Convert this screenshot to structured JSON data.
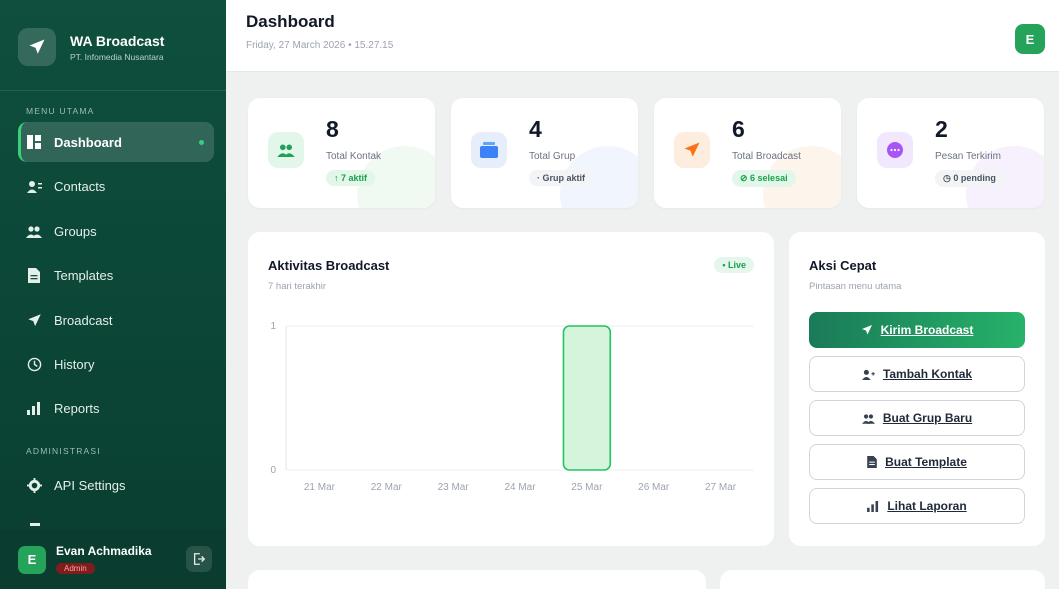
{
  "brand": {
    "name": "WA Broadcast",
    "subtitle": "PT. Infomedia Nusantara"
  },
  "sidebar": {
    "sections": {
      "main": "MENU UTAMA",
      "admin": "ADMINISTRASI"
    },
    "items": [
      {
        "label": "Dashboard",
        "icon": "dashboard-icon",
        "active": true
      },
      {
        "label": "Contacts",
        "icon": "contacts-icon"
      },
      {
        "label": "Groups",
        "icon": "groups-icon"
      },
      {
        "label": "Templates",
        "icon": "file-icon"
      },
      {
        "label": "Broadcast",
        "icon": "send-icon"
      },
      {
        "label": "History",
        "icon": "clock-icon"
      },
      {
        "label": "Reports",
        "icon": "bar-chart-icon"
      },
      {
        "label": "API Settings",
        "icon": "gear-icon"
      }
    ],
    "user": {
      "name": "Evan Achmadika",
      "role": "Admin",
      "initial": "E"
    }
  },
  "header": {
    "title": "Dashboard",
    "date": "Friday, 27 March 2026 • 15.27.15",
    "avatar_initial": "E"
  },
  "stats": [
    {
      "value": "8",
      "label": "Total Kontak",
      "badge": "↑ 7 aktif",
      "icon": "users-icon",
      "color": "#22a055"
    },
    {
      "value": "4",
      "label": "Total Grup",
      "badge": "· Grup aktif",
      "icon": "folder-icon",
      "color": "#3b82f6"
    },
    {
      "value": "6",
      "label": "Total Broadcast",
      "badge": "⊘ 6 selesai",
      "icon": "send-icon",
      "color": "#f97316"
    },
    {
      "value": "2",
      "label": "Pesan Terkirim",
      "badge": "◷ 0 pending",
      "icon": "chat-icon",
      "color": "#a855f7"
    }
  ],
  "activity": {
    "title": "Aktivitas Broadcast",
    "subtitle": "7 hari terakhir",
    "live": "• Live"
  },
  "chart_data": {
    "type": "bar",
    "categories": [
      "21 Mar",
      "22 Mar",
      "23 Mar",
      "24 Mar",
      "25 Mar",
      "26 Mar",
      "27 Mar"
    ],
    "values": [
      0,
      0,
      0,
      0,
      1,
      0,
      0
    ],
    "ylim": [
      0,
      1
    ],
    "yticks": [
      "0",
      "1"
    ],
    "title": "",
    "xlabel": "",
    "ylabel": "",
    "grid": true,
    "bar_color": "#d4f4dc",
    "bar_stroke": "#22c55e"
  },
  "quick": {
    "title": "Aksi Cepat",
    "subtitle": "Pintasan menu utama",
    "buttons": [
      {
        "label": "Kirim Broadcast",
        "icon": "send-icon"
      },
      {
        "label": "Tambah Kontak",
        "icon": "add-user-icon"
      },
      {
        "label": "Buat Grup Baru",
        "icon": "users-icon"
      },
      {
        "label": "Buat Template",
        "icon": "file-icon"
      },
      {
        "label": "Lihat Laporan",
        "icon": "bar-chart-icon"
      }
    ]
  }
}
